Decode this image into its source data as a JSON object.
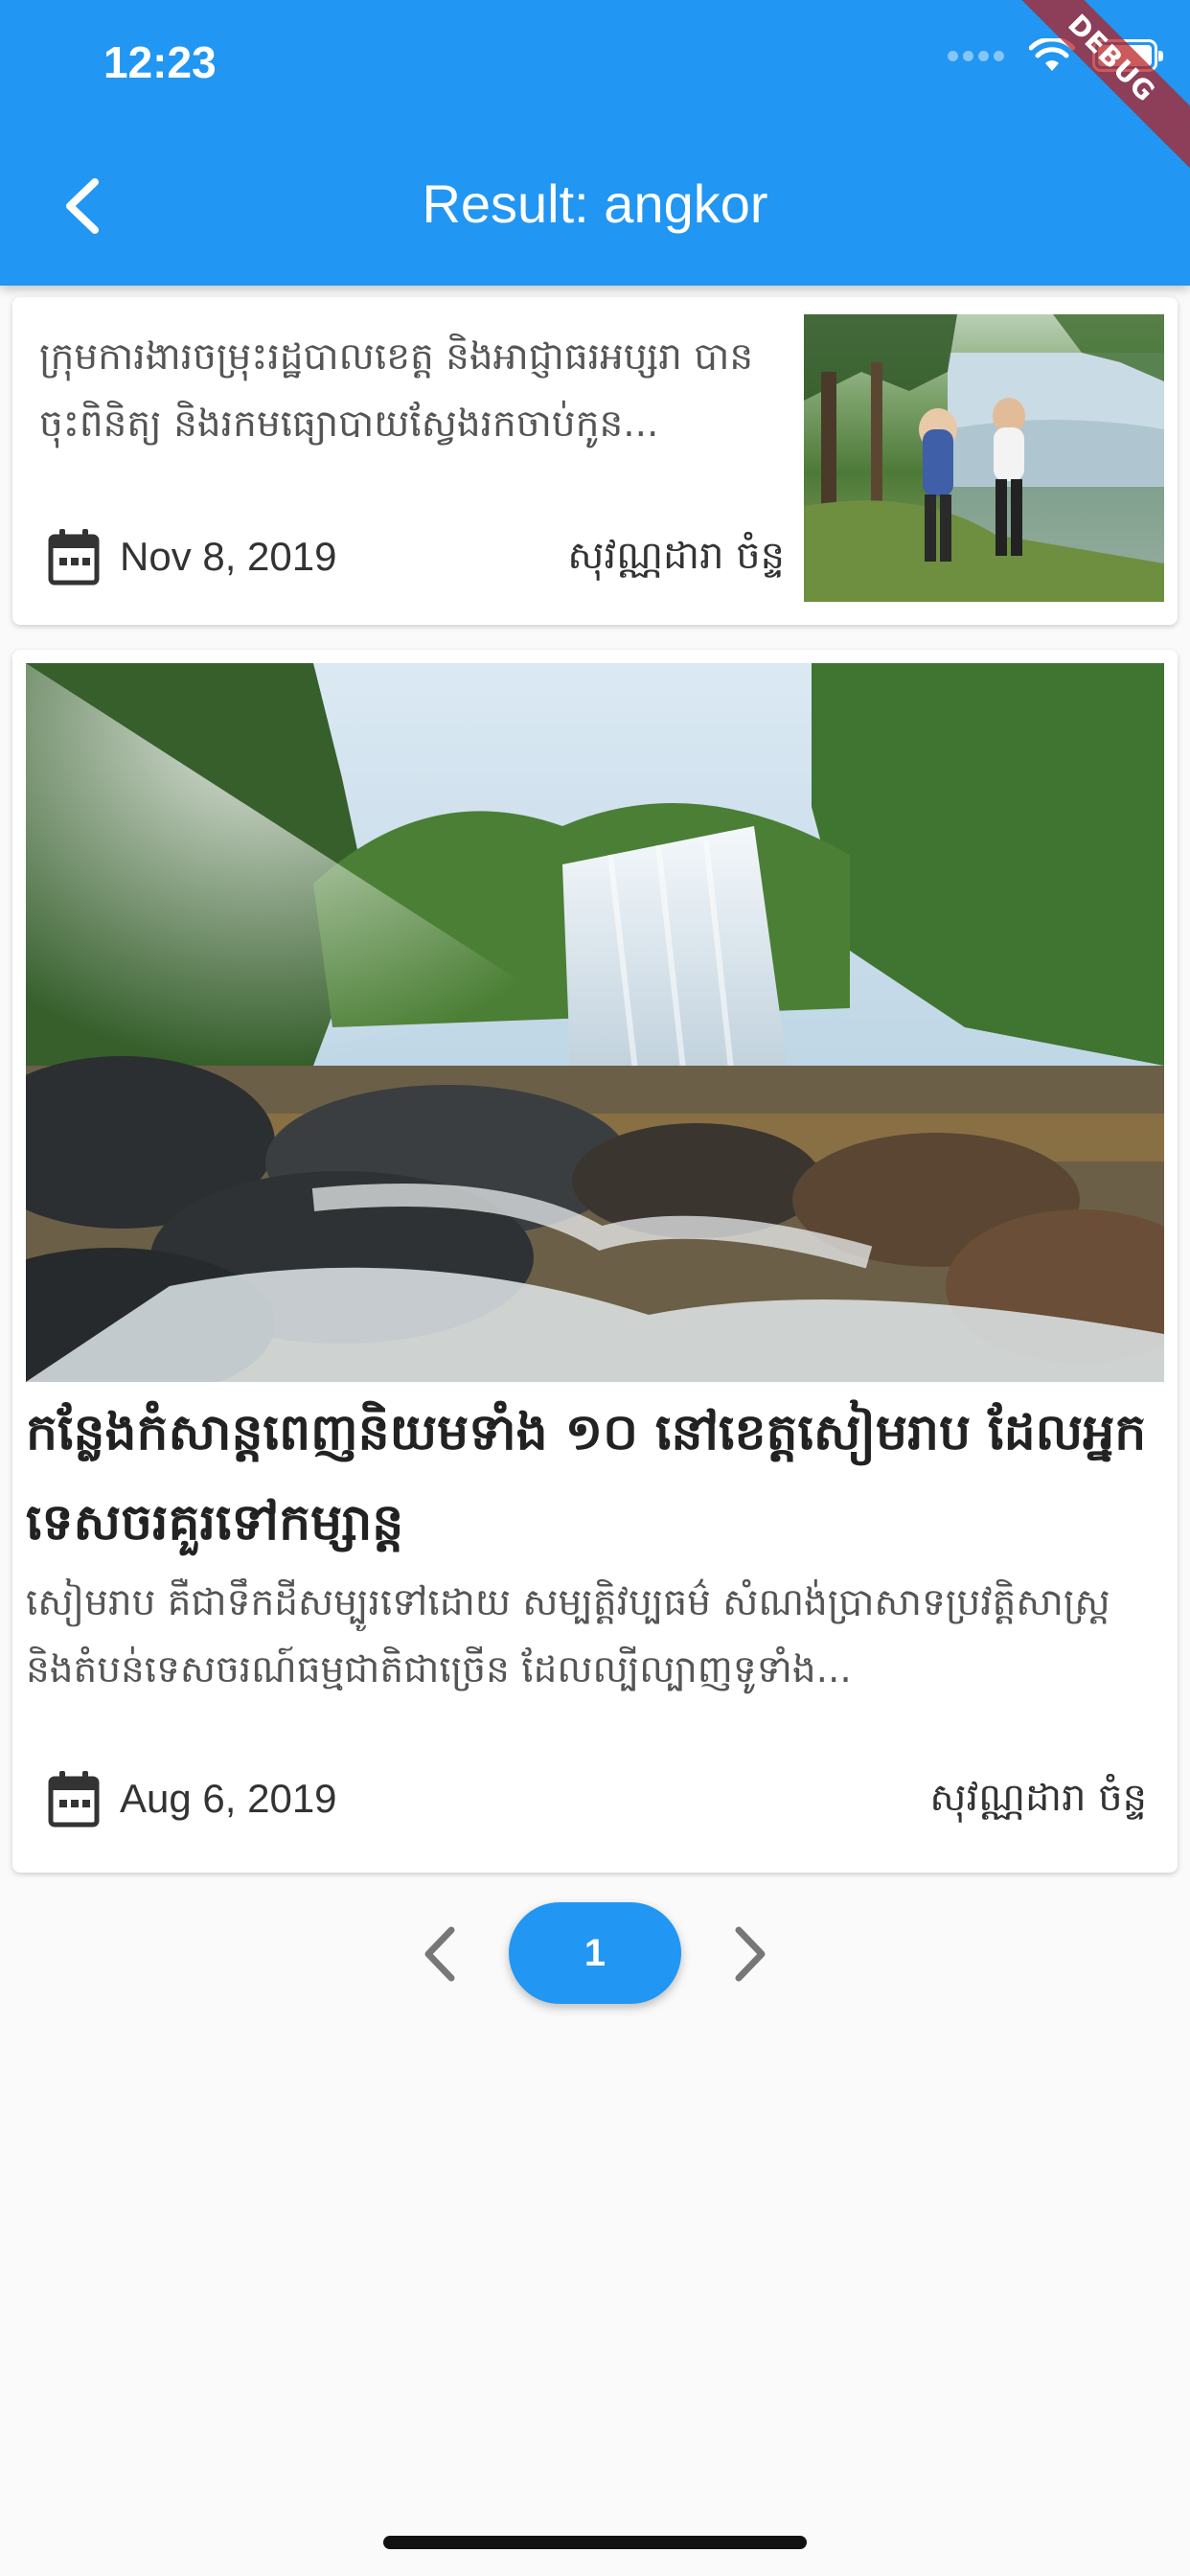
{
  "status_bar": {
    "time": "12:23"
  },
  "debug_banner": "DEBUG",
  "header": {
    "title": "Result: angkor"
  },
  "results": [
    {
      "excerpt": "ក្រុមការងារចម្រុះរដ្ឋបាលខេត្ត និងអាជ្ញាធរអប្សរា បានចុះពិនិត្យ និងរកមធ្យោបាយស្វែងរកចាប់កូន...",
      "date": "Nov 8, 2019",
      "author": "សុវណ្ណដារា ចំន្ទ"
    },
    {
      "title": "កន្លែងកំសាន្តពេញនិយមទាំង ១០ នៅខេត្តសៀមរាប  ដែលអ្នកទេសចរគួរទៅកម្សាន្ត",
      "excerpt": "សៀមរាប គឺជាទឹកដីសម្បូរទៅដោយ សម្បត្តិវប្បធម៌ សំណង់ប្រាសាទប្រវត្តិសាស្ត្រ និងតំបន់ទេសចរណ៍ធម្មជាតិជាច្រើន ដែលល្បីល្បាញទូទាំង...",
      "date": "Aug 6, 2019",
      "author": "សុវណ្ណដារា ចំន្ទ"
    }
  ],
  "pagination": {
    "current": "1"
  },
  "colors": {
    "primary": "#2196f3",
    "debug": "#b71c1c"
  }
}
